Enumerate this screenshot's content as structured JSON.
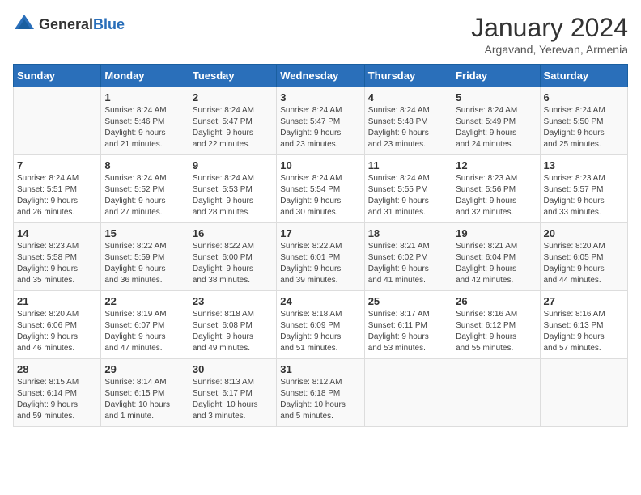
{
  "header": {
    "logo_general": "General",
    "logo_blue": "Blue",
    "month_title": "January 2024",
    "subtitle": "Argavand, Yerevan, Armenia"
  },
  "days_of_week": [
    "Sunday",
    "Monday",
    "Tuesday",
    "Wednesday",
    "Thursday",
    "Friday",
    "Saturday"
  ],
  "weeks": [
    [
      {
        "day": "",
        "info": ""
      },
      {
        "day": "1",
        "info": "Sunrise: 8:24 AM\nSunset: 5:46 PM\nDaylight: 9 hours\nand 21 minutes."
      },
      {
        "day": "2",
        "info": "Sunrise: 8:24 AM\nSunset: 5:47 PM\nDaylight: 9 hours\nand 22 minutes."
      },
      {
        "day": "3",
        "info": "Sunrise: 8:24 AM\nSunset: 5:47 PM\nDaylight: 9 hours\nand 23 minutes."
      },
      {
        "day": "4",
        "info": "Sunrise: 8:24 AM\nSunset: 5:48 PM\nDaylight: 9 hours\nand 23 minutes."
      },
      {
        "day": "5",
        "info": "Sunrise: 8:24 AM\nSunset: 5:49 PM\nDaylight: 9 hours\nand 24 minutes."
      },
      {
        "day": "6",
        "info": "Sunrise: 8:24 AM\nSunset: 5:50 PM\nDaylight: 9 hours\nand 25 minutes."
      }
    ],
    [
      {
        "day": "7",
        "info": "Sunrise: 8:24 AM\nSunset: 5:51 PM\nDaylight: 9 hours\nand 26 minutes."
      },
      {
        "day": "8",
        "info": "Sunrise: 8:24 AM\nSunset: 5:52 PM\nDaylight: 9 hours\nand 27 minutes."
      },
      {
        "day": "9",
        "info": "Sunrise: 8:24 AM\nSunset: 5:53 PM\nDaylight: 9 hours\nand 28 minutes."
      },
      {
        "day": "10",
        "info": "Sunrise: 8:24 AM\nSunset: 5:54 PM\nDaylight: 9 hours\nand 30 minutes."
      },
      {
        "day": "11",
        "info": "Sunrise: 8:24 AM\nSunset: 5:55 PM\nDaylight: 9 hours\nand 31 minutes."
      },
      {
        "day": "12",
        "info": "Sunrise: 8:23 AM\nSunset: 5:56 PM\nDaylight: 9 hours\nand 32 minutes."
      },
      {
        "day": "13",
        "info": "Sunrise: 8:23 AM\nSunset: 5:57 PM\nDaylight: 9 hours\nand 33 minutes."
      }
    ],
    [
      {
        "day": "14",
        "info": "Sunrise: 8:23 AM\nSunset: 5:58 PM\nDaylight: 9 hours\nand 35 minutes."
      },
      {
        "day": "15",
        "info": "Sunrise: 8:22 AM\nSunset: 5:59 PM\nDaylight: 9 hours\nand 36 minutes."
      },
      {
        "day": "16",
        "info": "Sunrise: 8:22 AM\nSunset: 6:00 PM\nDaylight: 9 hours\nand 38 minutes."
      },
      {
        "day": "17",
        "info": "Sunrise: 8:22 AM\nSunset: 6:01 PM\nDaylight: 9 hours\nand 39 minutes."
      },
      {
        "day": "18",
        "info": "Sunrise: 8:21 AM\nSunset: 6:02 PM\nDaylight: 9 hours\nand 41 minutes."
      },
      {
        "day": "19",
        "info": "Sunrise: 8:21 AM\nSunset: 6:04 PM\nDaylight: 9 hours\nand 42 minutes."
      },
      {
        "day": "20",
        "info": "Sunrise: 8:20 AM\nSunset: 6:05 PM\nDaylight: 9 hours\nand 44 minutes."
      }
    ],
    [
      {
        "day": "21",
        "info": "Sunrise: 8:20 AM\nSunset: 6:06 PM\nDaylight: 9 hours\nand 46 minutes."
      },
      {
        "day": "22",
        "info": "Sunrise: 8:19 AM\nSunset: 6:07 PM\nDaylight: 9 hours\nand 47 minutes."
      },
      {
        "day": "23",
        "info": "Sunrise: 8:18 AM\nSunset: 6:08 PM\nDaylight: 9 hours\nand 49 minutes."
      },
      {
        "day": "24",
        "info": "Sunrise: 8:18 AM\nSunset: 6:09 PM\nDaylight: 9 hours\nand 51 minutes."
      },
      {
        "day": "25",
        "info": "Sunrise: 8:17 AM\nSunset: 6:11 PM\nDaylight: 9 hours\nand 53 minutes."
      },
      {
        "day": "26",
        "info": "Sunrise: 8:16 AM\nSunset: 6:12 PM\nDaylight: 9 hours\nand 55 minutes."
      },
      {
        "day": "27",
        "info": "Sunrise: 8:16 AM\nSunset: 6:13 PM\nDaylight: 9 hours\nand 57 minutes."
      }
    ],
    [
      {
        "day": "28",
        "info": "Sunrise: 8:15 AM\nSunset: 6:14 PM\nDaylight: 9 hours\nand 59 minutes."
      },
      {
        "day": "29",
        "info": "Sunrise: 8:14 AM\nSunset: 6:15 PM\nDaylight: 10 hours\nand 1 minute."
      },
      {
        "day": "30",
        "info": "Sunrise: 8:13 AM\nSunset: 6:17 PM\nDaylight: 10 hours\nand 3 minutes."
      },
      {
        "day": "31",
        "info": "Sunrise: 8:12 AM\nSunset: 6:18 PM\nDaylight: 10 hours\nand 5 minutes."
      },
      {
        "day": "",
        "info": ""
      },
      {
        "day": "",
        "info": ""
      },
      {
        "day": "",
        "info": ""
      }
    ]
  ]
}
